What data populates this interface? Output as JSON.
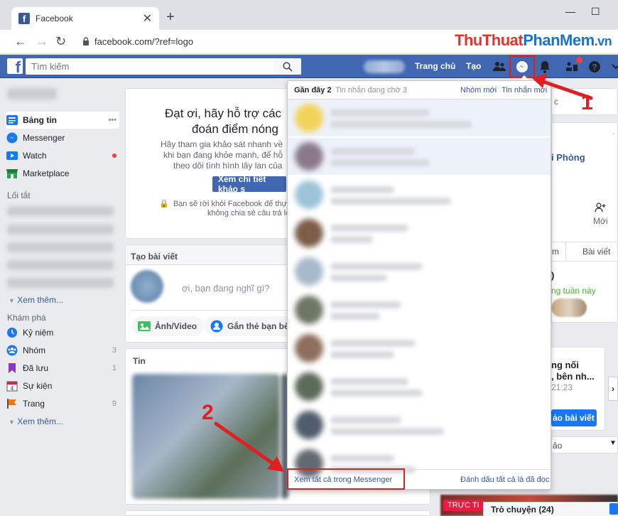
{
  "browser": {
    "tab_title": "Facebook",
    "url": "facebook.com/?ref=logo",
    "watermark": {
      "part1": "Thu",
      "part2": "Thuat",
      "part3": "PhanMem",
      "part4": ".vn"
    }
  },
  "header": {
    "search_placeholder": "Tìm kiếm",
    "nav": [
      "Trang chủ",
      "Tạo"
    ]
  },
  "sidebar": {
    "items": [
      {
        "label": "Bảng tin",
        "extra": "•••"
      },
      {
        "label": "Messenger"
      },
      {
        "label": "Watch"
      },
      {
        "label": "Marketplace"
      }
    ],
    "shortcuts_title": "Lối tắt",
    "see_more_1": "Xem thêm...",
    "explore_title": "Khám phá",
    "explore": [
      {
        "label": "Kỷ niệm",
        "count": ""
      },
      {
        "label": "Nhóm",
        "count": "3"
      },
      {
        "label": "Đã lưu",
        "count": "1"
      },
      {
        "label": "Sự kiện",
        "count": ""
      },
      {
        "label": "Trang",
        "count": "9"
      }
    ],
    "see_more_2": "Xem thêm..."
  },
  "survey": {
    "title_line1": "Đạt ơi, hãy hỗ trợ các",
    "title_line2": "đoán điểm nóng",
    "text1": "Hãy tham gia khảo sát nhanh về",
    "text2": "khi bạn đang khỏe mạnh, để hỗ",
    "text3": "theo dõi tình hình lây lan của",
    "button": "Xem chi tiết khảo s",
    "note1": "Bạn sẽ rời khỏi Facebook để thực",
    "note2": "không chia sẻ câu trả lời"
  },
  "composer": {
    "header": "Tạo bài viết",
    "placeholder": "ơi, bạn đang nghĩ gì?",
    "photo_btn": "Ảnh/Video",
    "tag_btn": "Gắn thẻ bạn bè"
  },
  "stories": {
    "title": "Tin"
  },
  "messenger_dropdown": {
    "tab_recent": "Gần đây",
    "tab_recent_count": "2",
    "tab_pending": "Tin nhắn đang chờ 3",
    "new_group": "Nhóm mới",
    "separator": " · ",
    "new_message": "Tin nhắn mới",
    "see_all": "Xem tất cả trong Messenger",
    "mark_all_read": "Đánh dấu tất cả là đã đọc"
  },
  "right_column": {
    "frag_c": "c",
    "frag_city": "i Phòng",
    "new_label": "Mới",
    "tab_m": "m",
    "tab_posts": "Bài viết",
    "frag_paren": ")",
    "frag_week": "ng tuần này",
    "frag_news1": "ng nối",
    "frag_news2": ", bên nh...",
    "frag_time": "21:23",
    "frag_btn": "ảo bài viết",
    "frag_ao": "ảo"
  },
  "annotations": {
    "step1": "1",
    "step2": "2"
  },
  "chat": {
    "label": "Trò chuyện (24)",
    "live": "TRỰC TI"
  },
  "colors": {
    "fb_blue": "#4267b2",
    "highlight_red": "#e02020",
    "link": "#365899"
  }
}
